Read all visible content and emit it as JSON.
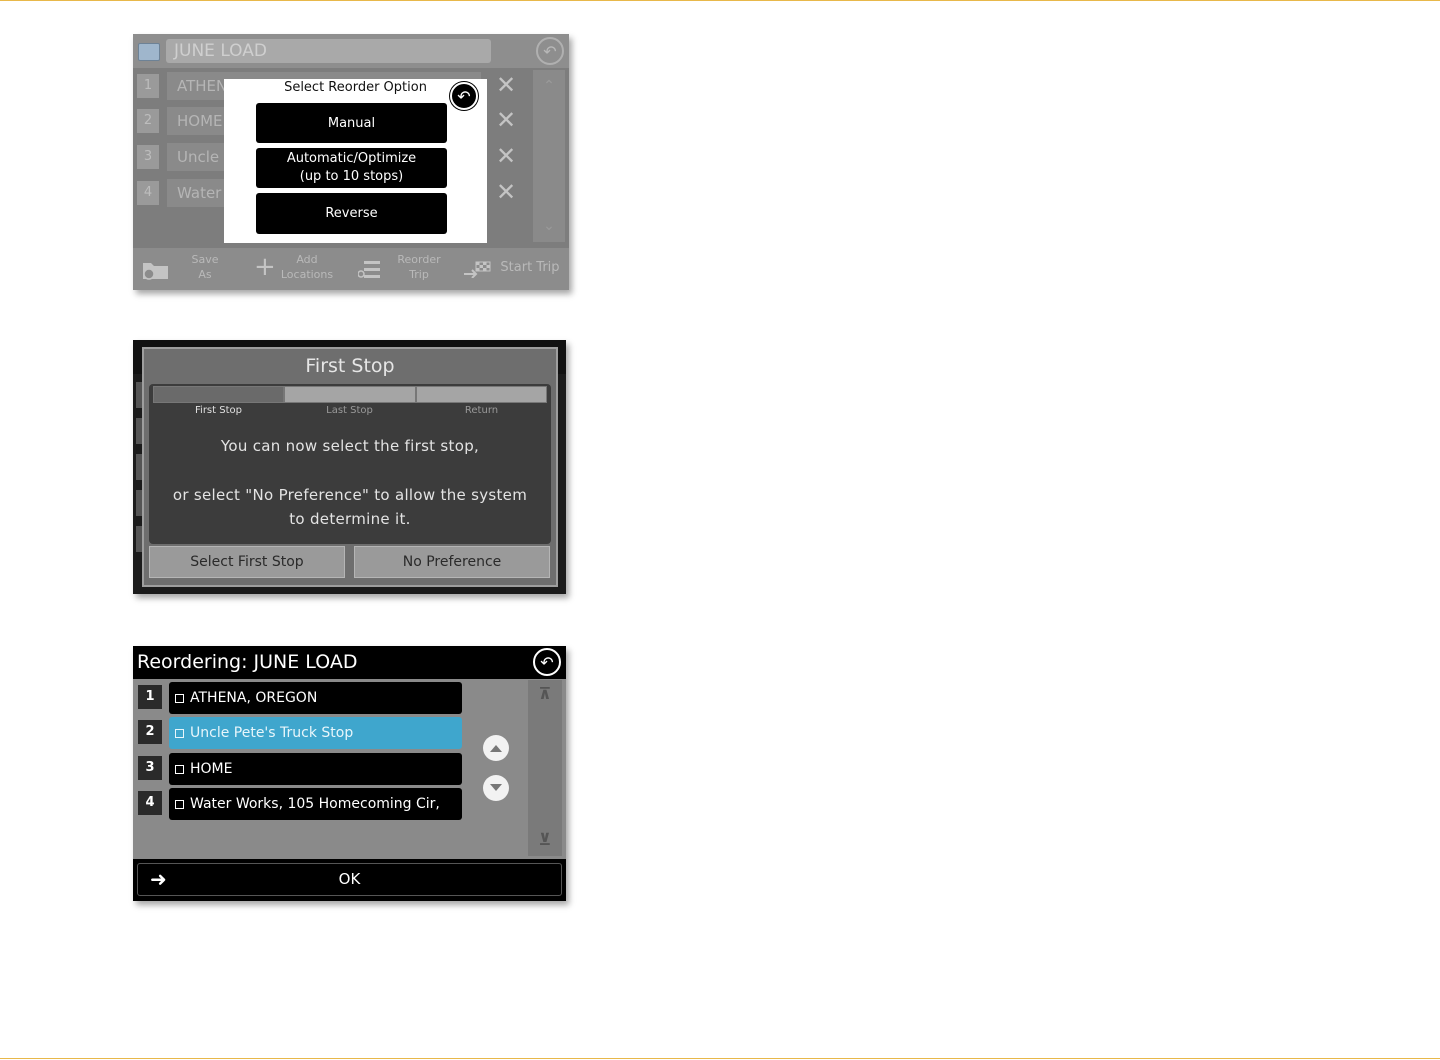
{
  "screen1": {
    "title": "JUNE LOAD",
    "rows": [
      {
        "num": "1",
        "label": "ATHEN"
      },
      {
        "num": "2",
        "label": "HOME"
      },
      {
        "num": "3",
        "label": "Uncle"
      },
      {
        "num": "4",
        "label": "Water"
      }
    ],
    "toolbar": {
      "save_as": "Save As",
      "add_locations": "Add Locations",
      "reorder_trip": "Reorder Trip",
      "start_trip": "Start Trip"
    },
    "modal": {
      "title": "Select Reorder Option",
      "manual": "Manual",
      "automatic_line1": "Automatic/Optimize",
      "automatic_line2": "(up to 10 stops)",
      "reverse": "Reverse"
    }
  },
  "screen2": {
    "title": "First Stop",
    "steps": [
      {
        "label": "First Stop",
        "active": true
      },
      {
        "label": "Last Stop",
        "active": false
      },
      {
        "label": "Return",
        "active": false
      }
    ],
    "message_line1": "You can now select the first stop,",
    "message_line2": "or select \"No Preference\" to allow the system",
    "message_line3": "to determine it.",
    "select_button": "Select First Stop",
    "no_pref_button": "No Preference"
  },
  "screen3": {
    "title": "Reordering: JUNE LOAD",
    "rows": [
      {
        "num": "1",
        "label": "ATHENA, OREGON",
        "selected": false
      },
      {
        "num": "2",
        "label": "Uncle Pete's Truck Stop",
        "selected": true
      },
      {
        "num": "3",
        "label": "HOME",
        "selected": false
      },
      {
        "num": "4",
        "label": "Water Works, 105 Homecoming Cir,",
        "selected": false
      }
    ],
    "ok_label": "OK"
  },
  "colors": {
    "accent_rule": "#e8b84a",
    "selected_row": "#3fa6cd"
  },
  "icons": [
    "folder-icon",
    "back-arrow-icon",
    "close-icon",
    "scroll-top-icon",
    "scroll-bottom-icon",
    "move-up-icon",
    "move-down-icon",
    "arrow-right-icon",
    "plus-icon",
    "reorder-icon",
    "checkered-flag-icon"
  ]
}
